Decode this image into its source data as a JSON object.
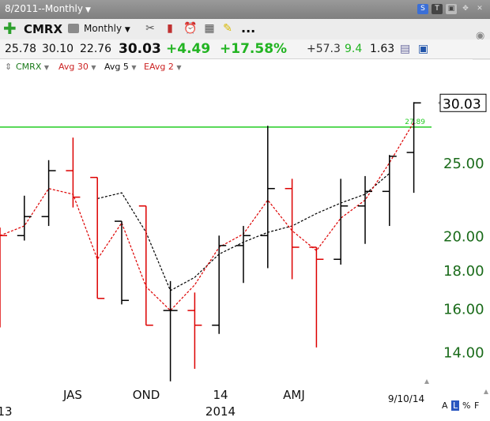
{
  "header": {
    "period_label": "8/2011--Monthly",
    "icons": [
      "s-badge-icon",
      "t-badge-icon",
      "save-icon",
      "move-icon",
      "close-icon"
    ]
  },
  "toolbar": {
    "symbol": "CMRX",
    "interval": "Monthly",
    "more": "..."
  },
  "quote": {
    "open": "25.78",
    "high": "30.10",
    "low": "22.76",
    "close": "30.03",
    "change": "+4.49",
    "change_pct": "+17.58%",
    "v1": "+57.3",
    "v2": "9.4",
    "v3": "1.63"
  },
  "legend": {
    "symbol": "CMRX",
    "avg30": "Avg 30",
    "avg5": "Avg 5",
    "eavg2": "EAvg 2"
  },
  "colors": {
    "up_bar": "#000000",
    "down_bar": "#dd0000",
    "avg5": "#000000",
    "eavg2": "#dd0000",
    "hline": "#22cc22",
    "axis_text": "#1a6b1a",
    "change_green": "#22b422"
  },
  "bottom_controls": {
    "a": "A",
    "l": "L",
    "pct": "%",
    "f": "F"
  },
  "chart_data": {
    "type": "ohlc",
    "y_scale": "log",
    "ylim": [
      12.7,
      32.0
    ],
    "y_ticks": [
      "14.00",
      "16.00",
      "18.00",
      "20.00",
      "25.00"
    ],
    "last_price_label": "30.03",
    "hline": {
      "value": 27.89,
      "label": "27.89"
    },
    "x_labels": [
      {
        "text": "JAS",
        "row": 1
      },
      {
        "text": "OND",
        "row": 1
      },
      {
        "text": "14",
        "row": 1
      },
      {
        "text": "AMJ",
        "row": 1
      },
      {
        "text": "13",
        "row": 2
      },
      {
        "text": "2014",
        "row": 2
      },
      {
        "text": "9/10/14",
        "row": 1
      }
    ],
    "bars": [
      {
        "o": null,
        "h": 20.5,
        "l": 15.1,
        "c": 20.0,
        "dir": "down"
      },
      {
        "o": 20.0,
        "h": 22.6,
        "l": 19.7,
        "c": 21.2,
        "dir": "up"
      },
      {
        "o": 21.2,
        "h": 25.2,
        "l": 20.6,
        "c": 24.4,
        "dir": "up"
      },
      {
        "o": 24.4,
        "h": 27.0,
        "l": 21.8,
        "c": 22.5,
        "dir": "down"
      },
      {
        "o": 23.9,
        "h": 23.9,
        "l": 16.5,
        "c": 16.5,
        "dir": "down"
      },
      {
        "o": 20.9,
        "h": 20.9,
        "l": 16.2,
        "c": 16.4,
        "dir": "up"
      },
      {
        "o": 21.9,
        "h": 21.9,
        "l": 15.2,
        "c": 15.2,
        "dir": "down"
      },
      {
        "o": 15.9,
        "h": 17.4,
        "l": 12.8,
        "c": 15.9,
        "dir": "up"
      },
      {
        "o": 15.9,
        "h": 16.8,
        "l": 13.3,
        "c": 15.2,
        "dir": "down"
      },
      {
        "o": 15.2,
        "h": 20.0,
        "l": 14.8,
        "c": 19.4,
        "dir": "up"
      },
      {
        "o": 19.4,
        "h": 20.6,
        "l": 17.3,
        "c": 20.0,
        "dir": "up"
      },
      {
        "o": 20.0,
        "h": 28.0,
        "l": 18.1,
        "c": 23.1,
        "dir": "up"
      },
      {
        "o": 23.1,
        "h": 23.8,
        "l": 17.5,
        "c": 19.3,
        "dir": "down"
      },
      {
        "o": 19.3,
        "h": 19.3,
        "l": 14.2,
        "c": 18.6,
        "dir": "down"
      },
      {
        "o": 18.6,
        "h": 23.8,
        "l": 18.3,
        "c": 21.9,
        "dir": "up"
      },
      {
        "o": 21.9,
        "h": 24.0,
        "l": 19.5,
        "c": 22.9,
        "dir": "up"
      },
      {
        "o": 22.9,
        "h": 25.6,
        "l": 20.6,
        "c": 25.5,
        "dir": "up"
      },
      {
        "o": 25.8,
        "h": 30.1,
        "l": 22.8,
        "c": 30.03,
        "dir": "up"
      }
    ],
    "avg5": [
      null,
      null,
      null,
      null,
      22.4,
      22.8,
      20.2,
      16.9,
      17.6,
      18.9,
      19.6,
      20.2,
      20.6,
      21.4,
      22.1,
      22.7,
      24.2
    ],
    "eavg2": [
      20.0,
      20.6,
      23.1,
      22.7,
      18.6,
      20.8,
      17.1,
      15.9,
      17.2,
      19.3,
      20.1,
      22.3,
      20.3,
      19.1,
      21.1,
      22.3,
      25.0,
      28.3
    ]
  }
}
